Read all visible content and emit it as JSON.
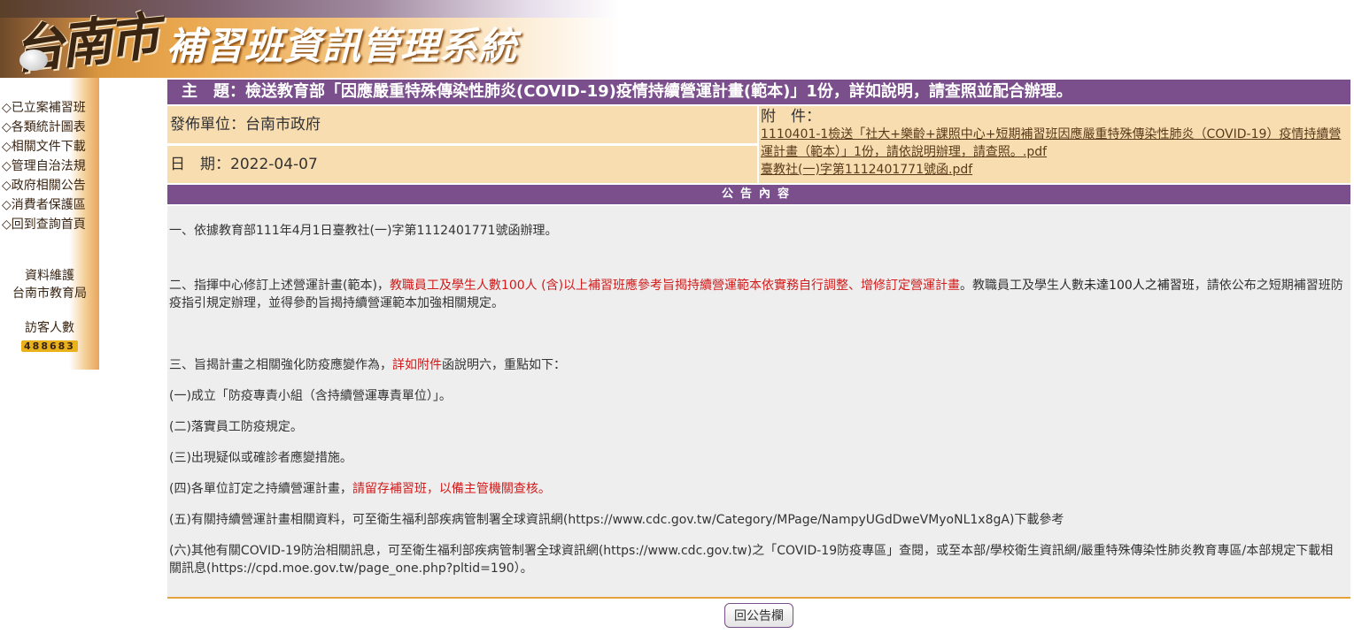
{
  "header": {
    "logo_city": "台南市",
    "system_title": "補習班資訊管理系統"
  },
  "sidebar": {
    "items": [
      {
        "label": "◇已立案補習班"
      },
      {
        "label": "◇各類統計圖表"
      },
      {
        "label": "◇相關文件下載"
      },
      {
        "label": "◇管理自治法規"
      },
      {
        "label": "◇政府相關公告"
      },
      {
        "label": "◇消費者保護區"
      },
      {
        "label": "◇回到查詢首頁"
      }
    ],
    "maintainer_label": "資料維護",
    "maintainer_name": "台南市教育局",
    "visitor_label": "訪客人數",
    "visitor_count": "488683"
  },
  "notice": {
    "subject": "主　題：檢送教育部「因應嚴重特殊傳染性肺炎(COVID-19)疫情持續營運計畫(範本)」1份，詳如說明，請查照並配合辦理。",
    "issuer": "發佈單位：台南市政府",
    "date": "日　期：2022-04-07",
    "attachment_label": "附　件：",
    "attachments": [
      "1110401-1檢送「社大+樂齡+課照中心+短期補習班因應嚴重特殊傳染性肺炎（COVID-19）疫情持續營運計畫（範本）」1份，請依說明辦理，請查照。.pdf",
      "臺教社(一)字第1112401771號函.pdf"
    ],
    "section_title": "公告內容"
  },
  "content": {
    "p1": "一、依據教育部111年4月1日臺教社(一)字第1112401771號函辦理。",
    "p2_a": "二、指揮中心修訂上述營運計畫(範本)，",
    "p2_b": "教職員工及學生人數100人 (含)以上補習班應參考旨揭持續營運範本依實務自行調整、增修訂定營運計畫",
    "p2_c": "。教職員工及學生人數",
    "p2_d": "未達100人之補習班",
    "p2_e": "，請依公布之短期補習班防疫指引規定辦理，並得參酌旨揭持續營運範本加強相關規定。",
    "p3_a": "三、旨揭計畫之相關強化防疫應變作為，",
    "p3_b": "詳如附件",
    "p3_c": "函說明六，重點如下：",
    "item1": "(一)成立「防疫專責小組（含持續營運專責單位）」。",
    "item2": "(二)落實員工防疫規定。",
    "item3": "(三)出現疑似或確診者應變措施。",
    "item4_a": "(四)各單位訂定之持續營運計畫，",
    "item4_b": "請留存補習班，以備主管機關查核。",
    "item5": "(五)有關持續營運計畫相關資料，可至衛生福利部疾病管制署全球資訊網(https://www.cdc.gov.tw/Category/MPage/NampyUGdDweVMyoNL1x8gA)下載參考",
    "item6": "(六)其他有關COVID-19防治相關訊息，可至衛生福利部疾病管制署全球資訊網(https://www.cdc.gov.tw)之「COVID-19防疫專區」查閱，或至本部/學校衛生資訊網/嚴重特殊傳染性肺炎教育專區/本部規定下載相關訊息(https://cpd.moe.gov.tw/page_one.php?pltid=190）。"
  },
  "footer": {
    "back_button": "回公告欄"
  },
  "colors": {
    "purple_bar": "#7a4f8c",
    "info_bg": "#f8ddb0",
    "content_bg": "#eeeeee",
    "highlight_red": "#d11a1a",
    "divider_orange": "#e6a23c"
  }
}
